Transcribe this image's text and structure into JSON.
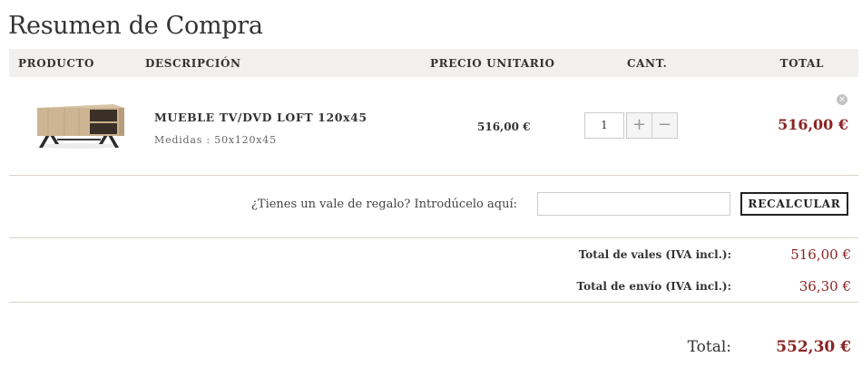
{
  "page": {
    "title": "Resumen de Compra"
  },
  "table": {
    "headers": {
      "product": "PRODUCTO",
      "description": "DESCRIPCIÓN",
      "unit_price": "PRECIO UNITARIO",
      "qty": "CANT.",
      "total": "TOTAL"
    },
    "items": [
      {
        "name": "MUEBLE TV/DVD LOFT 120x45",
        "meta": "Medidas : 50x120x45",
        "unit_price": "516,00 €",
        "qty": "1",
        "plus": "+",
        "minus": "−",
        "total": "516,00 €",
        "remove": "×",
        "image_icon": "tv-stand-image"
      }
    ]
  },
  "voucher": {
    "label": "¿Tienes un vale de regalo? Introdúcelo aquí:",
    "value": "",
    "button": "RECALCULAR"
  },
  "summary": {
    "vales_label": "Total de vales (IVA incl.):",
    "vales_value": "516,00 €",
    "envio_label": "Total de envío (IVA incl.):",
    "envio_value": "36,30 €",
    "total_label": "Total:",
    "total_value": "552,30 €"
  },
  "colors": {
    "accent": "#8b2323",
    "header_bg": "#f1f0ee",
    "divider": "#d9d2c5"
  }
}
